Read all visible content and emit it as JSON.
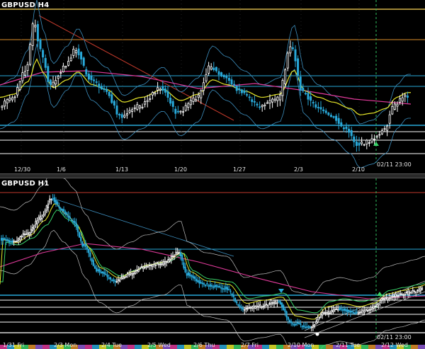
{
  "colors": {
    "background": "#000000",
    "hline_cyan": "#29a9d9",
    "hline_white": "#ffffff",
    "hline_gold": "#d4b44a",
    "hline_orange": "#e0902a",
    "ma_yellow": "#e6e62a",
    "ma_magenta": "#e03a9a",
    "ma_green": "#3ad46a",
    "band_steelblue": "#3d8fbf",
    "band_white": "#bdbdbd",
    "candle_up": "#ffffff",
    "candle_down": "#29a9d9",
    "vline_green": "#2fbf5f",
    "trend_red": "#c0392b"
  },
  "h4": {
    "title": "GBPUSD H4",
    "x_ticks": [
      "12/30",
      "1/6",
      "1/13",
      "1/20",
      "1/27",
      "2/3",
      "2/10"
    ],
    "cursor_time": "02/11 23:00"
  },
  "h1": {
    "title": "GBPUSD H1",
    "x_ticks": [
      "1/31 Fri",
      "2/3 Mon",
      "2/4 Tue",
      "2/5 Wed",
      "2/6 Thu",
      "2/7 Fri",
      "2/10 Mon",
      "2/11 Tue",
      "2/12 Wed"
    ],
    "cursor_time": "02/11 23:00"
  }
}
